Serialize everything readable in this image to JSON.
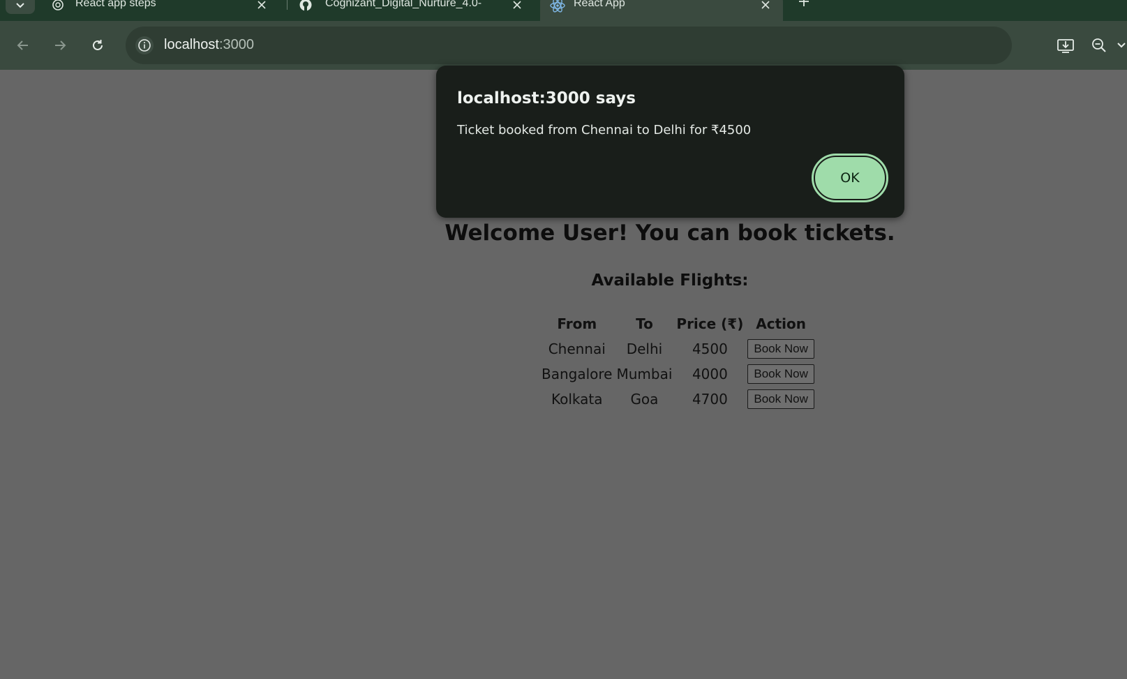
{
  "browser": {
    "tabs": [
      {
        "title": "React app steps",
        "icon": "openai-icon"
      },
      {
        "title": "Cognizant_Digital_Nurture_4.0-",
        "icon": "github-icon"
      },
      {
        "title": "React App",
        "icon": "react-icon"
      }
    ],
    "address": {
      "host": "localhost",
      "port": ":3000"
    }
  },
  "page": {
    "welcome": "Welcome User! You can book tickets.",
    "flights_heading": "Available Flights:",
    "table": {
      "headers": [
        "From",
        "To",
        "Price (₹)",
        "Action"
      ],
      "rows": [
        {
          "from": "Chennai",
          "to": "Delhi",
          "price": "4500",
          "action": "Book Now"
        },
        {
          "from": "Bangalore",
          "to": "Mumbai",
          "price": "4000",
          "action": "Book Now"
        },
        {
          "from": "Kolkata",
          "to": "Goa",
          "price": "4700",
          "action": "Book Now"
        }
      ]
    }
  },
  "dialog": {
    "title": "localhost:3000 says",
    "message": "Ticket booked from Chennai to Delhi for ₹4500",
    "ok_label": "OK"
  },
  "colors": {
    "tabstrip": "#1f3a2a",
    "toolbar": "#3a4a3f",
    "page_bg": "#666666",
    "dialog_bg": "#191e1a",
    "ok_button": "#9fdcaa"
  }
}
